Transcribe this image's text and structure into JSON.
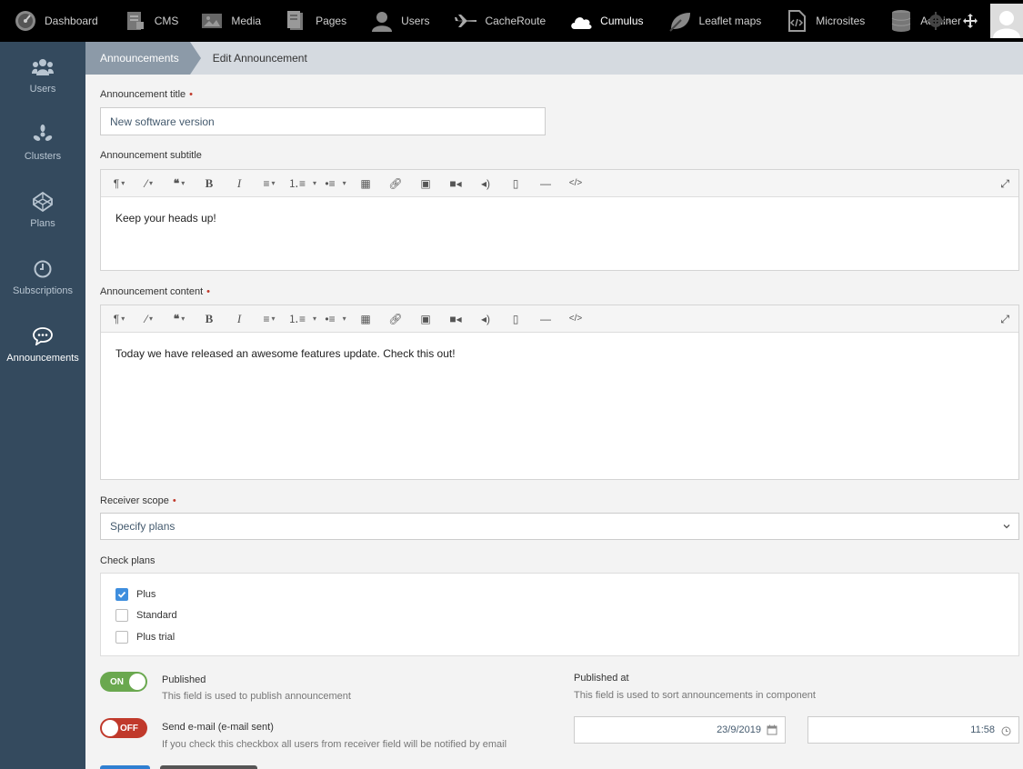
{
  "topnav": {
    "items": [
      {
        "label": "Dashboard",
        "icon": "dashboard-icon"
      },
      {
        "label": "CMS",
        "icon": "cms-icon"
      },
      {
        "label": "Media",
        "icon": "media-icon"
      },
      {
        "label": "Pages",
        "icon": "pages-icon"
      },
      {
        "label": "Users",
        "icon": "user-icon"
      },
      {
        "label": "CacheRoute",
        "icon": "plane-icon"
      },
      {
        "label": "Cumulus",
        "icon": "cloud-icon"
      },
      {
        "label": "Leaflet maps",
        "icon": "leaf-icon"
      },
      {
        "label": "Microsites",
        "icon": "code-file-icon"
      },
      {
        "label": "Adminer",
        "icon": "database-icon"
      }
    ],
    "active": "Cumulus"
  },
  "sidebar": {
    "items": [
      {
        "label": "Users",
        "icon": "users-icon"
      },
      {
        "label": "Clusters",
        "icon": "clusters-icon"
      },
      {
        "label": "Plans",
        "icon": "plans-icon"
      },
      {
        "label": "Subscriptions",
        "icon": "clock-icon"
      },
      {
        "label": "Announcements",
        "icon": "chat-icon"
      }
    ],
    "active": "Announcements"
  },
  "breadcrumb": {
    "parent": "Announcements",
    "current": "Edit Announcement"
  },
  "form": {
    "title_label": "Announcement title",
    "title_value": "New software version",
    "subtitle_label": "Announcement subtitle",
    "subtitle_value": "Keep your heads up!",
    "content_label": "Announcement content",
    "content_value": "Today we have released an awesome features update. Check this out!",
    "scope_label": "Receiver scope",
    "scope_value": "Specify plans",
    "plans_label": "Check plans",
    "plans": [
      {
        "label": "Plus",
        "checked": true
      },
      {
        "label": "Standard",
        "checked": false
      },
      {
        "label": "Plus trial",
        "checked": false
      }
    ],
    "published": {
      "toggle_label": "ON",
      "title": "Published",
      "help": "This field is used to publish announcement"
    },
    "send_email": {
      "toggle_label": "OFF",
      "title": "Send e-mail (e-mail sent)",
      "help": "If you check this checkbox all users from receiver field will be notified by email"
    },
    "published_at": {
      "title": "Published at",
      "help": "This field is used to sort announcements in component",
      "date": "23/9/2019",
      "time": "11:58"
    }
  },
  "colors": {
    "topbar": "#000000",
    "sidebar": "#344a5e",
    "toggle_on": "#6aa84f",
    "toggle_off": "#c0392b",
    "checkbox_on": "#3e8ede"
  }
}
